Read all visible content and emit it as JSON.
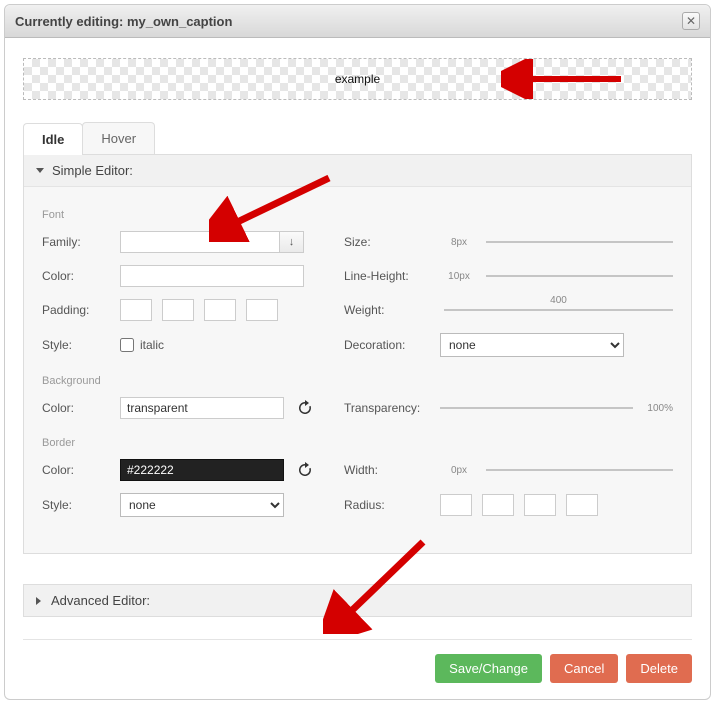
{
  "dialog": {
    "title": "Currently editing: my_own_caption"
  },
  "preview": {
    "text": "example"
  },
  "tabs": {
    "idle": "Idle",
    "hover": "Hover"
  },
  "acc": {
    "simple": "Simple Editor:",
    "advanced": "Advanced Editor:"
  },
  "sections": {
    "font": "Font",
    "background": "Background",
    "border": "Border"
  },
  "labels": {
    "family": "Family:",
    "color": "Color:",
    "padding": "Padding:",
    "style": "Style:",
    "size": "Size:",
    "lineheight": "Line-Height:",
    "weight": "Weight:",
    "decoration": "Decoration:",
    "bgcolor": "Color:",
    "transparency": "Transparency:",
    "bcolor": "Color:",
    "bstyle": "Style:",
    "width": "Width:",
    "radius": "Radius:",
    "italic": "italic"
  },
  "values": {
    "family": "",
    "fontcolor": "",
    "size_label": "8px",
    "lineheight_label": "10px",
    "weight_label": "400",
    "decoration": "none",
    "bgcolor": "transparent",
    "transparency_label": "100%",
    "bordercolor": "#222222",
    "borderstyle": "none",
    "width_label": "0px"
  },
  "buttons": {
    "save": "Save/Change",
    "cancel": "Cancel",
    "delete": "Delete"
  }
}
